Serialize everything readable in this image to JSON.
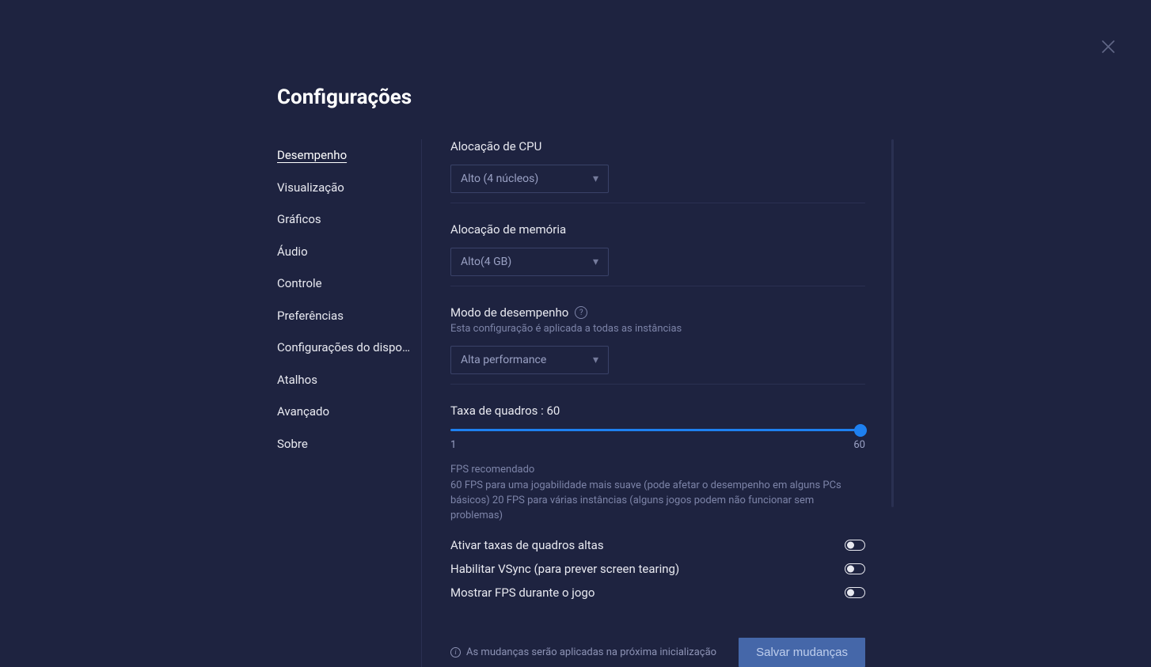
{
  "title": "Configurações",
  "sidebar": {
    "items": [
      {
        "label": "Desempenho",
        "active": true
      },
      {
        "label": "Visualização"
      },
      {
        "label": "Gráficos"
      },
      {
        "label": "Áudio"
      },
      {
        "label": "Controle"
      },
      {
        "label": "Preferências"
      },
      {
        "label": "Configurações do dispositi..."
      },
      {
        "label": "Atalhos"
      },
      {
        "label": "Avançado"
      },
      {
        "label": "Sobre"
      }
    ]
  },
  "cpu": {
    "label": "Alocação de CPU",
    "value": "Alto (4 núcleos)"
  },
  "memory": {
    "label": "Alocação de memória",
    "value": "Alto(4 GB)"
  },
  "perf_mode": {
    "label": "Modo de desempenho",
    "sub": "Esta configuração é aplicada a todas as instâncias",
    "value": "Alta performance"
  },
  "fps": {
    "label": "Taxa de quadros : 60",
    "min": "1",
    "max": "60",
    "hint_title": "FPS recomendado",
    "hint_body": "60 FPS para uma jogabilidade mais suave (pode afetar o desempenho em alguns PCs básicos) 20 FPS para várias instâncias (alguns jogos podem não funcionar sem problemas)"
  },
  "toggles": {
    "high_fps": "Ativar taxas de quadros altas",
    "vsync": "Habilitar VSync (para prever screen tearing)",
    "show_fps": "Mostrar FPS durante o jogo"
  },
  "footer": {
    "note": "As mudanças serão aplicadas na próxima inicialização",
    "save": "Salvar mudanças"
  }
}
